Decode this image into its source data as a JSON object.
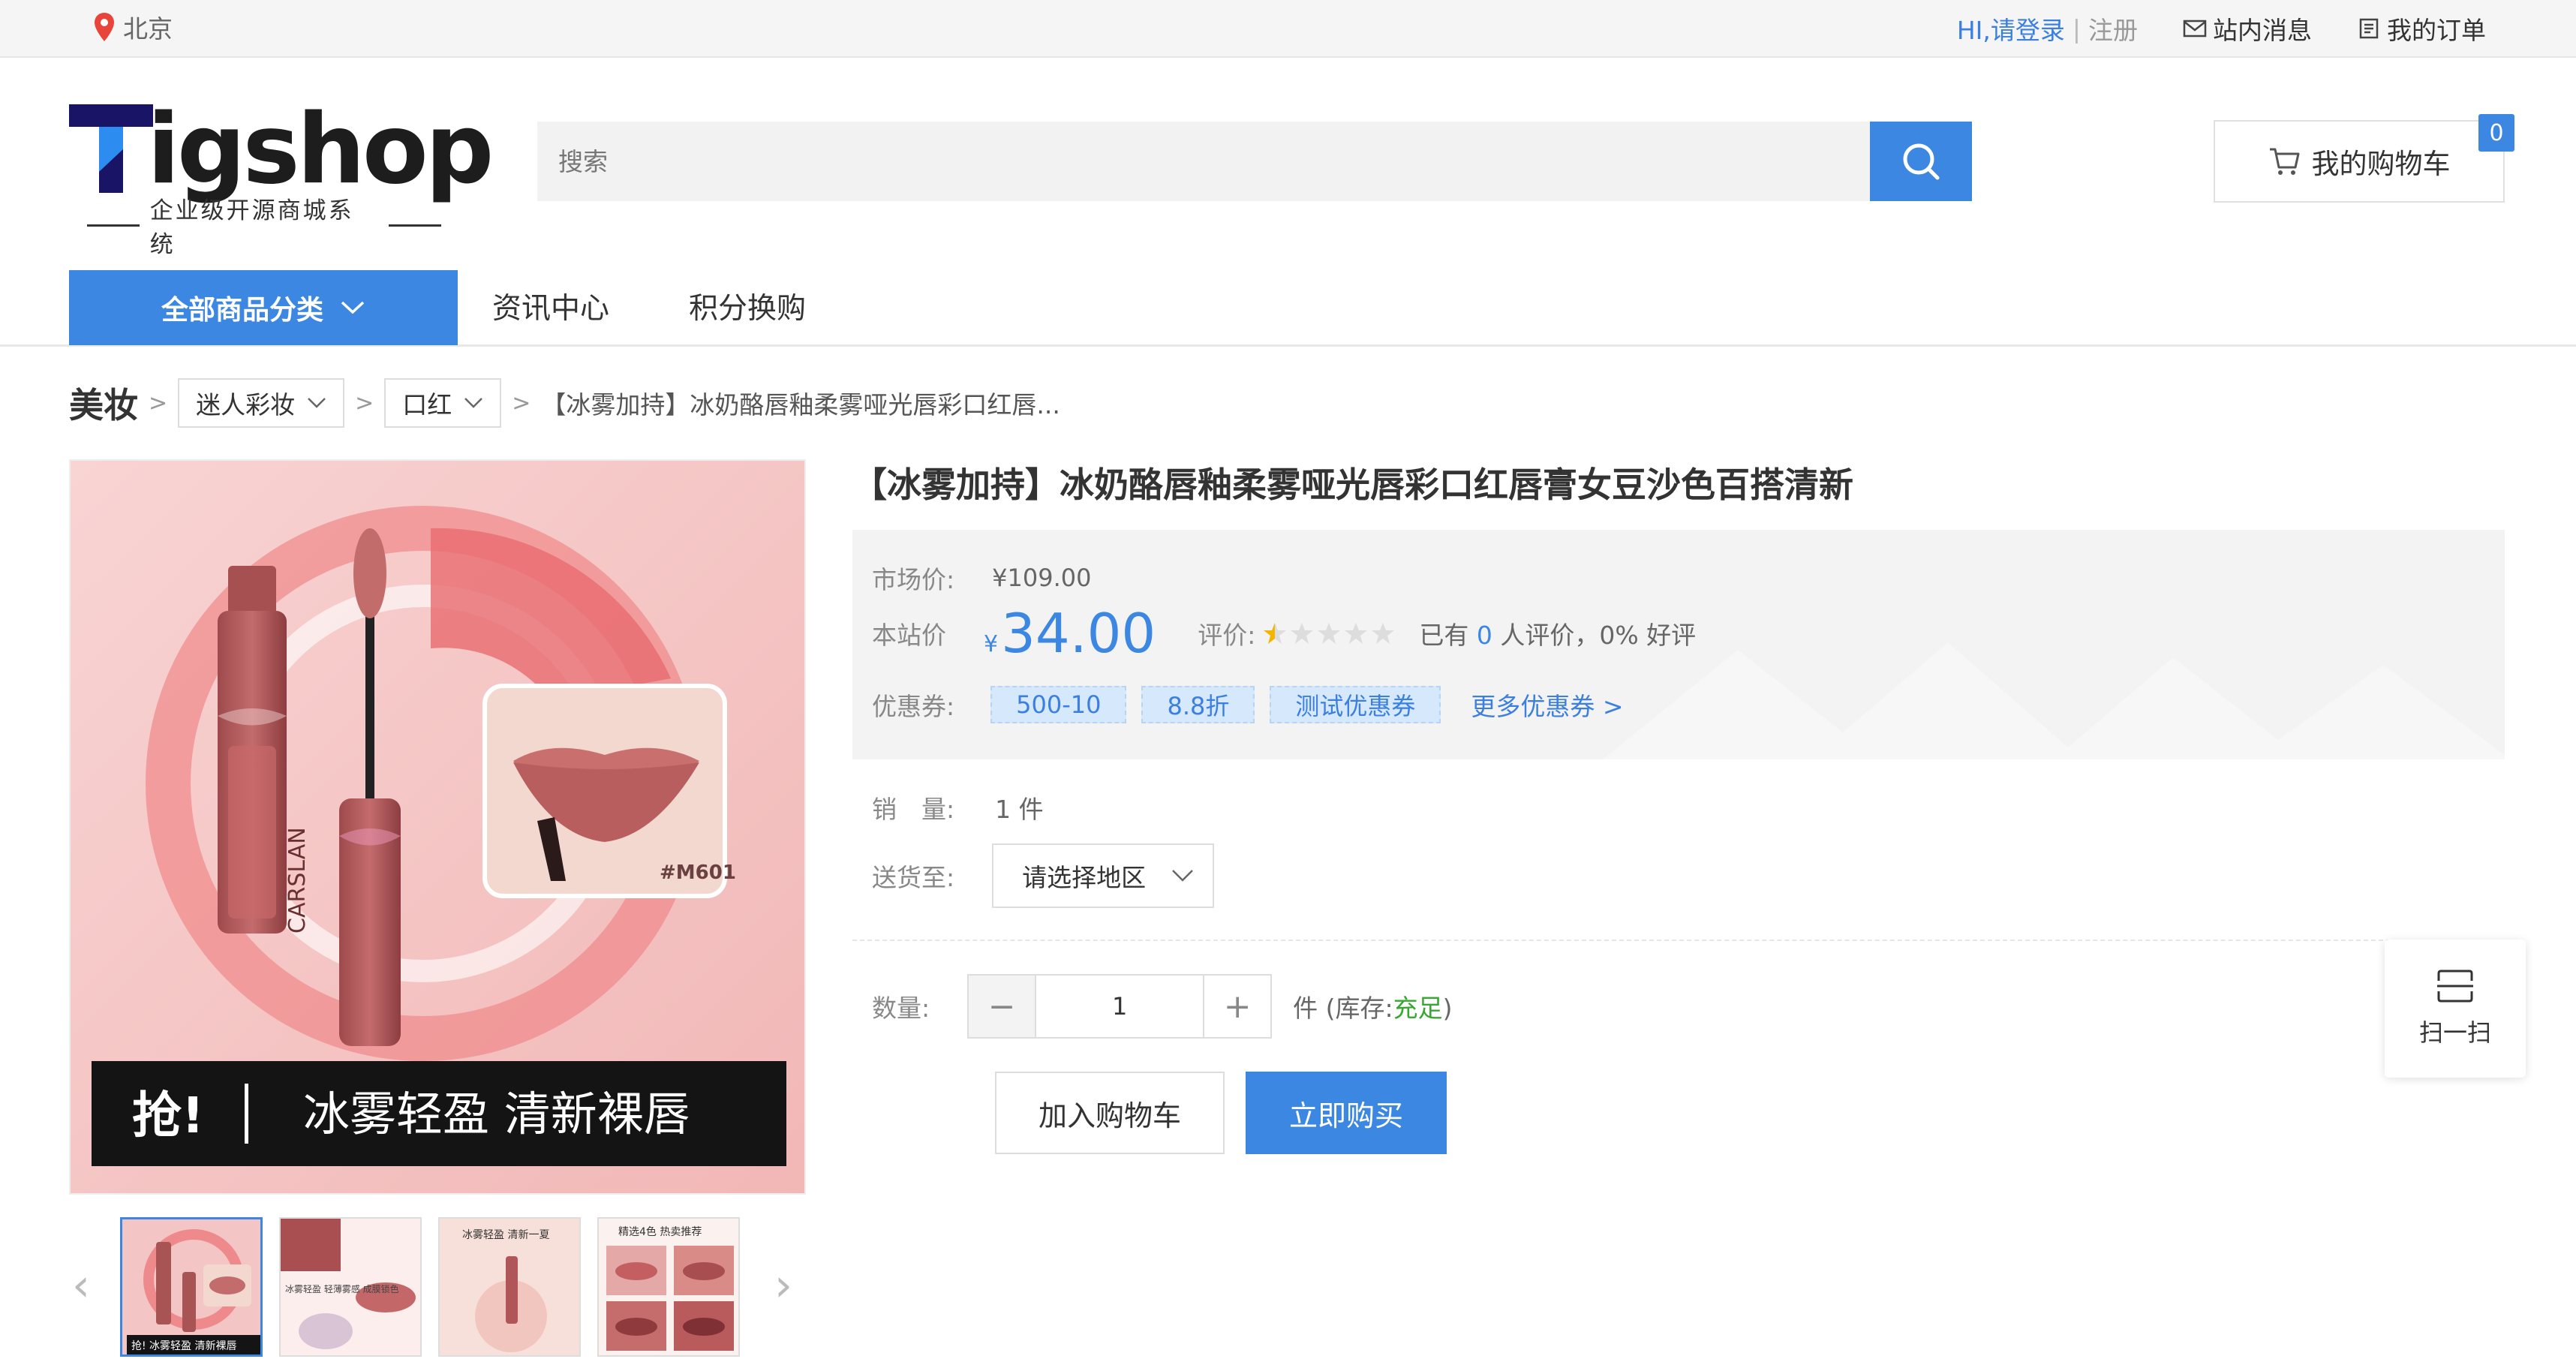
{
  "topbar": {
    "location": "北京",
    "login": "HI,请登录",
    "separator": "|",
    "register": "注册",
    "messages": "站内消息",
    "orders": "我的订单"
  },
  "logo": {
    "brand": "igshop",
    "slogan": "企业级开源商城系统"
  },
  "search": {
    "placeholder": "搜索"
  },
  "cart": {
    "label": "我的购物车",
    "count": "0"
  },
  "nav": {
    "all_categories": "全部商品分类",
    "items": [
      "资讯中心",
      "积分换购"
    ]
  },
  "breadcrumb": {
    "root": "美妆",
    "level1": "迷人彩妆",
    "level2": "口红",
    "current": "【冰雾加持】冰奶酪唇釉柔雾哑光唇彩口红唇..."
  },
  "gallery": {
    "banner_text_left": "抢!",
    "banner_text_right": "冰雾轻盈 清新裸唇",
    "shade_code": "#M601",
    "bottle_text": "CARSLAN",
    "thumbnails": [
      {
        "text": "抢! 冰雾轻盈 清新裸唇"
      },
      {
        "text": "冰雾轻盈 轻薄雾感 成膜锁色"
      },
      {
        "text": "冰雾轻盈 清新一夏"
      },
      {
        "text": "精选4色 热卖推荐"
      }
    ]
  },
  "product": {
    "title": "【冰雾加持】冰奶酪唇釉柔雾哑光唇彩口红唇膏女豆沙色百搭清新",
    "market_price_label": "市场价:",
    "market_price": "¥109.00",
    "site_price_label": "本站价",
    "currency": "¥",
    "site_price": "34.00",
    "rating_label": "评价:",
    "rating": 0.5,
    "reviews_prefix": "已有",
    "reviews_count": "0",
    "reviews_suffix": "人评价，0% 好评",
    "coupon_label": "优惠券:",
    "coupons": [
      "500-10",
      "8.8折",
      "测试优惠券"
    ],
    "more_coupons": "更多优惠券 >",
    "sales_label": "销　量:",
    "sales_value": "1 件",
    "ship_label": "送货至:",
    "region_placeholder": "请选择地区",
    "qty_label": "数量:",
    "qty_minus": "−",
    "qty_value": "1",
    "qty_plus": "+",
    "unit": "件",
    "stock_prefix": "(库存:",
    "stock_status": "充足",
    "stock_suffix": ")",
    "add_to_cart": "加入购物车",
    "buy_now": "立即购买"
  },
  "scan": {
    "label": "扫一扫"
  },
  "colors": {
    "accent": "#3b87e2",
    "link": "#3b7fe0",
    "stock_ok": "#38a832",
    "pin": "#e8443a"
  }
}
